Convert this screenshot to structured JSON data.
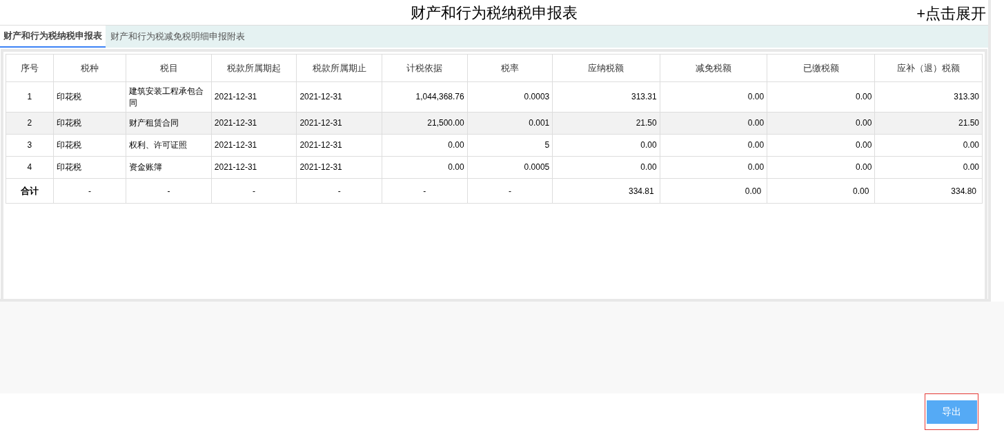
{
  "title": "财产和行为税纳税申报表",
  "expand_link": "+点击展开",
  "tabs": [
    {
      "label": "财产和行为税纳税申报表",
      "selected": true
    },
    {
      "label": "财产和行为税减免税明细申报附表",
      "selected": false
    }
  ],
  "table": {
    "columns": [
      "序号",
      "税种",
      "税目",
      "税款所属期起",
      "税款所属期止",
      "计税依据",
      "税率",
      "应纳税额",
      "减免税额",
      "已缴税额",
      "应补（退）税额"
    ],
    "rows": [
      {
        "highlighted": false,
        "cells": [
          "1",
          "印花税",
          "建筑安装工程承包合同",
          "2021-12-31",
          "2021-12-31",
          "1,044,368.76",
          "0.0003",
          "313.31",
          "0.00",
          "0.00",
          "313.30"
        ]
      },
      {
        "highlighted": true,
        "cells": [
          "2",
          "印花税",
          "财产租赁合同",
          "2021-12-31",
          "2021-12-31",
          "21,500.00",
          "0.001",
          "21.50",
          "0.00",
          "0.00",
          "21.50"
        ]
      },
      {
        "highlighted": false,
        "cells": [
          "3",
          "印花税",
          "权利、许可证照",
          "2021-12-31",
          "2021-12-31",
          "0.00",
          "5",
          "0.00",
          "0.00",
          "0.00",
          "0.00"
        ]
      },
      {
        "highlighted": false,
        "cells": [
          "4",
          "印花税",
          "资金账簿",
          "2021-12-31",
          "2021-12-31",
          "0.00",
          "0.0005",
          "0.00",
          "0.00",
          "0.00",
          "0.00"
        ]
      }
    ],
    "total": [
      "合计",
      "-",
      "-",
      "-",
      "-",
      "-",
      "-",
      "334.81",
      "0.00",
      "0.00",
      "334.80"
    ]
  },
  "export_button": "导出"
}
